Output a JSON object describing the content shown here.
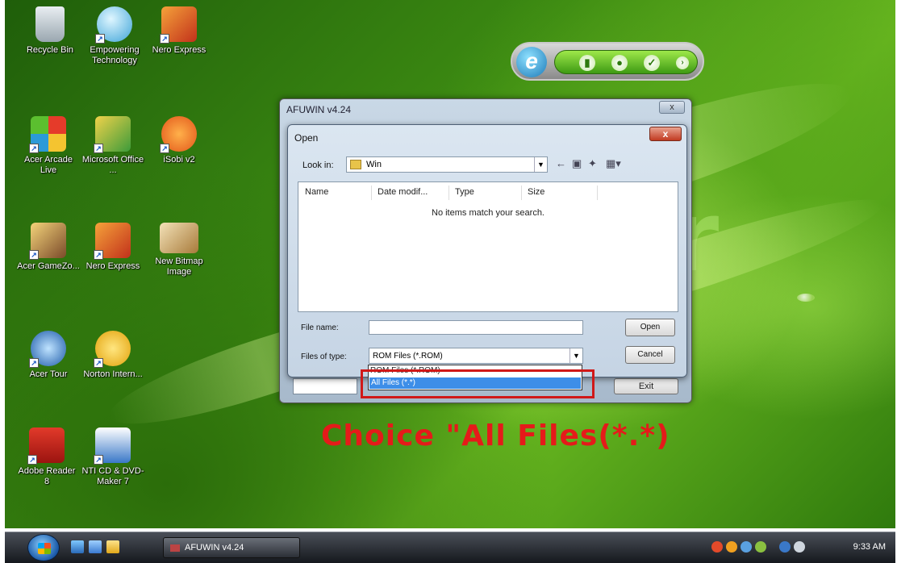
{
  "desktop": {
    "icons": [
      {
        "label": "Recycle Bin",
        "name": "recycle-bin-icon"
      },
      {
        "label": "Empowering Technology",
        "name": "empowering-technology-icon"
      },
      {
        "label": "Nero Express",
        "name": "nero-express-icon"
      },
      {
        "label": "Acer Arcade Live",
        "name": "acer-arcade-live-icon"
      },
      {
        "label": "Microsoft Office ...",
        "name": "microsoft-office-icon"
      },
      {
        "label": "iSobi v2",
        "name": "isobi-icon"
      },
      {
        "label": "Acer GameZo...",
        "name": "acer-gamezone-icon"
      },
      {
        "label": "Nero Express",
        "name": "nero-express-2-icon"
      },
      {
        "label": "New Bitmap Image",
        "name": "new-bitmap-image-icon"
      },
      {
        "label": "Acer Tour",
        "name": "acer-tour-icon"
      },
      {
        "label": "Norton Intern...",
        "name": "norton-internet-icon"
      },
      {
        "label": "Adobe Reader 8",
        "name": "adobe-reader-icon"
      },
      {
        "label": "NTI CD & DVD-Maker 7",
        "name": "nti-cd-dvd-maker-icon"
      }
    ]
  },
  "afuwin": {
    "title": "AFUWIN v4.24",
    "close_label": "x",
    "exit_label": "Exit"
  },
  "open_dialog": {
    "title": "Open",
    "close_label": "x",
    "look_in_label": "Look in:",
    "look_in_value": "Win",
    "columns": [
      "Name",
      "Date modif...",
      "Type",
      "Size"
    ],
    "empty_message": "No items match your search.",
    "file_name_label": "File name:",
    "file_name_value": "",
    "files_of_type_label": "Files of type:",
    "files_of_type_value": "ROM Files (*.ROM)",
    "open_button": "Open",
    "cancel_button": "Cancel",
    "dropdown_options": [
      "ROM Files (*.ROM)",
      "All Files (*.*)"
    ],
    "selected_option_index": 1
  },
  "annotation": {
    "text": "Choice  \"All Files(*.*)",
    "color": "#e51a1a"
  },
  "taskbar": {
    "task_label": "AFUWIN v4.24",
    "clock": "9:33 AM"
  }
}
